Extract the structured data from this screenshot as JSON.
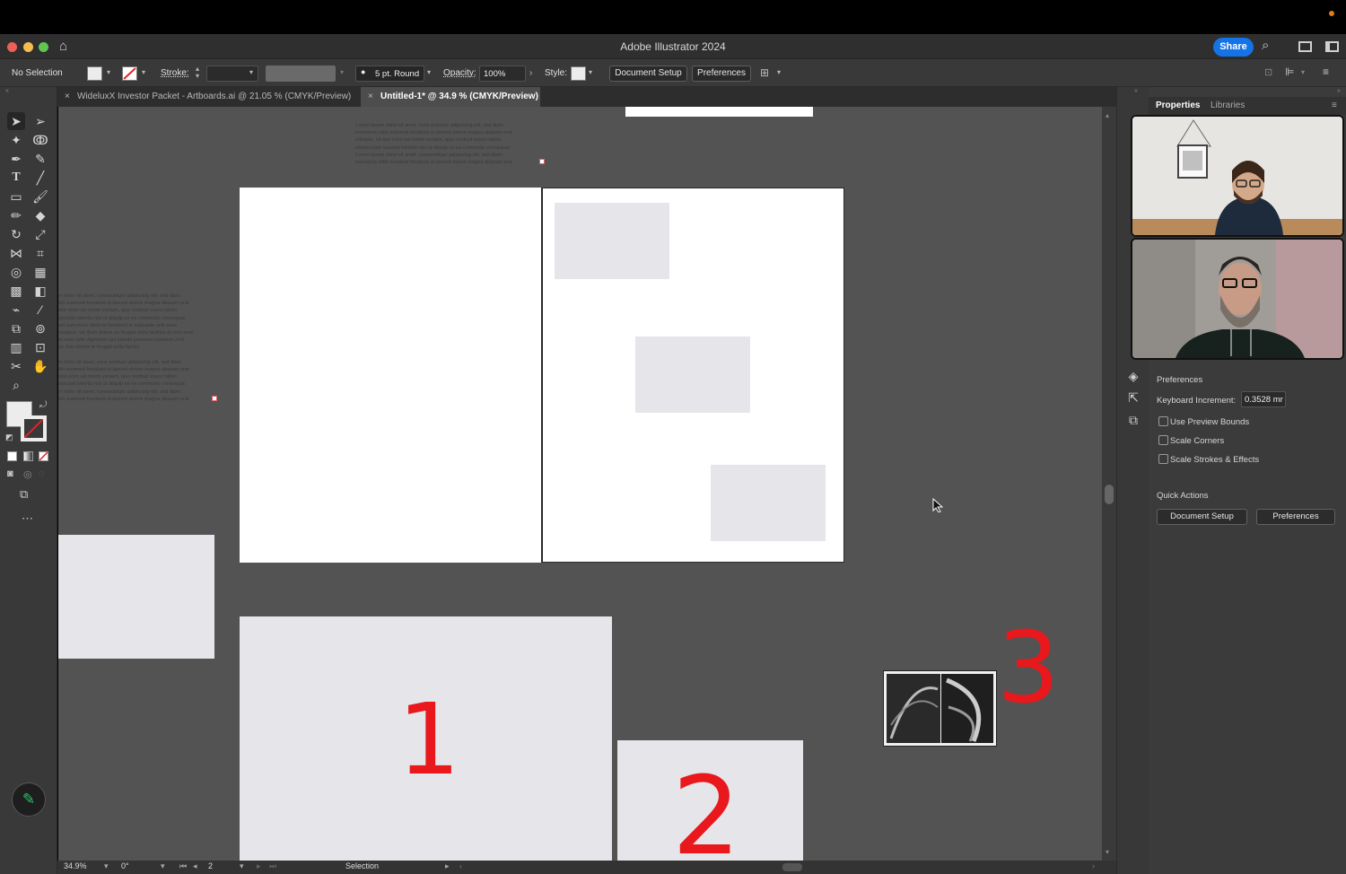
{
  "window": {
    "title": "Adobe Illustrator 2024",
    "share_label": "Share"
  },
  "control_bar": {
    "selection_status": "No Selection",
    "stroke_label": "Stroke:",
    "brush_label": "5 pt. Round",
    "opacity_label": "Opacity:",
    "opacity_value": "100%",
    "style_label": "Style:",
    "document_setup_label": "Document Setup",
    "preferences_label": "Preferences"
  },
  "tabs": [
    {
      "label": "WideluxX Investor Packet - Artboards.ai @ 21.05 % (CMYK/Preview)",
      "active": false
    },
    {
      "label": "Untitled-1* @ 34.9 % (CMYK/Preview)",
      "active": true
    }
  ],
  "canvas": {
    "lorem_top": "Lorem ipsum dolor sit amet, cons ectetuer adipiscing elit, sed diam\nnonummy nibh euismod tincidunt ut laoreet dolore magna aliquam erat\nvolutpat. Ut wisi enim ad minim veniam, quis nostrud exerci tation\nullamcorper suscipit lobortis nisl ut aliquip ex ea commodo consequat.\nLorem ipsum dolor sit amet, consectetuer adipiscing elit, sed diam\nnonummy nibh euismod tincidunt ut laoreet dolore magna aliquam erat",
    "lorem_top_fragment": "laoreet augue duis dolore te feugait nulla facilisi.",
    "lorem_left": "m dolor sit amet, consectetuer adipiscing elit, sed diam\nibh euismod tincidunt ut laoreet dolore magna aliquam erat\nwisi enim ad minim veniam, quis nostrud exerci tation\nsuscipit lobortis nisl ut aliquip ex ea commodo consequat.\nvel eum iriure dolor in hendrerit in vulputate velit esse\nnsequat, vel illum dolore eu feugiat nulla facilisis at vero eros\net iusto odio dignissim qui blandit praesent luptatum zzril\nue duis dolore te feugait nulla facilisi.\n\nm dolor sit amet, cons ectetuer adipiscing elit, sed diam\nibh euismod tincidunt ut laoreet dolore magna aliquam erat\nwisi enim ad minim veniam, quis nostrud exerci tation\nsuscipit lobortis nisl ut aliquip ex ea commodo consequat.\nm dolor sit amet, consectetuer adipiscing elit, sed diam\nibh euismod tincidunt ut laoreet dolore magna aliquam erat",
    "annotation_1": "1",
    "annotation_2": "2",
    "annotation_3": "3",
    "annotation_color": "#e8181c"
  },
  "status_bar": {
    "zoom": "34.9%",
    "rotation": "0°",
    "artboard_number": "2",
    "tool_name": "Selection"
  },
  "properties_panel": {
    "tab_properties": "Properties",
    "tab_libraries": "Libraries",
    "section_title": "Preferences",
    "keyboard_increment_label": "Keyboard Increment:",
    "keyboard_increment_value": "0.3528 mr",
    "checkboxes": [
      {
        "label": "Use Preview Bounds",
        "checked": false
      },
      {
        "label": "Scale Corners",
        "checked": false
      },
      {
        "label": "Scale Strokes & Effects",
        "checked": false
      }
    ],
    "quick_actions_title": "Quick Actions",
    "document_setup_label": "Document Setup",
    "preferences_label": "Preferences"
  },
  "colors": {
    "accent": "#1473e6",
    "canvas_bg": "#535353",
    "placeholder_fill": "#e6e5e9"
  }
}
